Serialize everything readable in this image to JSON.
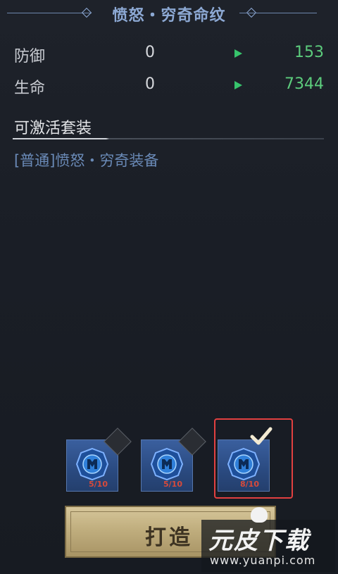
{
  "header": {
    "title": "愤怒・穷奇命纹"
  },
  "stats": [
    {
      "label": "防御",
      "current": "0",
      "next": "153"
    },
    {
      "label": "生命",
      "current": "0",
      "next": "7344"
    }
  ],
  "set_section": {
    "heading": "可激活套装",
    "items": [
      "[普通]愤怒・穷奇装备"
    ]
  },
  "slots": [
    {
      "count": "5/10",
      "selected": false
    },
    {
      "count": "5/10",
      "selected": false
    },
    {
      "count": "8/10",
      "selected": true
    }
  ],
  "forge_button": {
    "label": "打造"
  },
  "watermark": {
    "brand": "元皮下载",
    "url": "www.yuanpi.com"
  },
  "colors": {
    "title": "#8da9d4",
    "stat_increase": "#5ccc7c",
    "arrow": "#37c46c",
    "set_item": "#6a8ab7",
    "highlight_border": "#e24040",
    "slot_count": "#d84a3a"
  },
  "icons": {
    "arrow": "right-triangle-arrow-icon",
    "gem": "blue-rune-gem-icon",
    "check": "checkmark-icon",
    "diamond": "diamond-ornament-icon"
  }
}
